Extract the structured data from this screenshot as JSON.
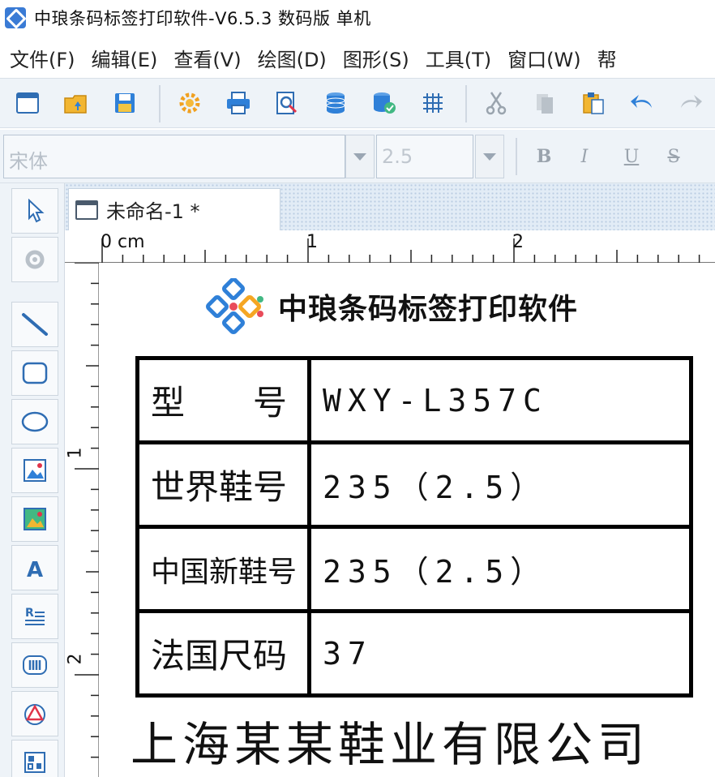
{
  "window": {
    "title": "中琅条码标签打印软件-V6.5.3 数码版 单机"
  },
  "menu": [
    {
      "label": "文件(F)"
    },
    {
      "label": "编辑(E)"
    },
    {
      "label": "查看(V)"
    },
    {
      "label": "绘图(D)"
    },
    {
      "label": "图形(S)"
    },
    {
      "label": "工具(T)"
    },
    {
      "label": "窗口(W)"
    },
    {
      "label": "帮"
    }
  ],
  "toolbar": {
    "buttons": [
      "new-icon",
      "open-icon",
      "save-icon",
      "settings-icon",
      "print-icon",
      "print-preview-icon",
      "database-icon",
      "database-settings-icon",
      "grid-icon",
      "cut-icon",
      "copy-icon",
      "paste-icon",
      "undo-icon",
      "redo-icon"
    ]
  },
  "fontbar": {
    "font_name": "宋体",
    "font_size": "2.5",
    "bold": "B",
    "italic": "I",
    "underline": "U",
    "strike": "S"
  },
  "tools": [
    "pointer-icon",
    "rotate-icon",
    "line-icon",
    "rounded-rect-icon",
    "ellipse-icon",
    "image-icon",
    "picture-icon",
    "text-icon",
    "richtext-icon",
    "barcode-icon",
    "shape-icon",
    "qrcode-icon"
  ],
  "document": {
    "tab_label": "未命名-1 *"
  },
  "ruler": {
    "top": [
      "0 cm",
      "1",
      "2"
    ],
    "left": [
      "1",
      "2"
    ]
  },
  "label": {
    "brand_name": "中琅条码标签打印软件",
    "rows": [
      {
        "key": "型　　号",
        "value": "WXY-L357C"
      },
      {
        "key": "世界鞋号",
        "value": "235（2.5）"
      },
      {
        "key": "中国新鞋号",
        "value": "235（2.5）"
      },
      {
        "key": "法国尺码",
        "value": "37"
      }
    ],
    "company": "上海某某鞋业有限公司"
  },
  "colors": {
    "toolbar_bg": "#eef3f8",
    "app_icon": "#3a7bd5",
    "logo_blue": "#2f80d8",
    "logo_orange": "#f5a623",
    "logo_red": "#e94b5a",
    "logo_green": "#42b883"
  }
}
